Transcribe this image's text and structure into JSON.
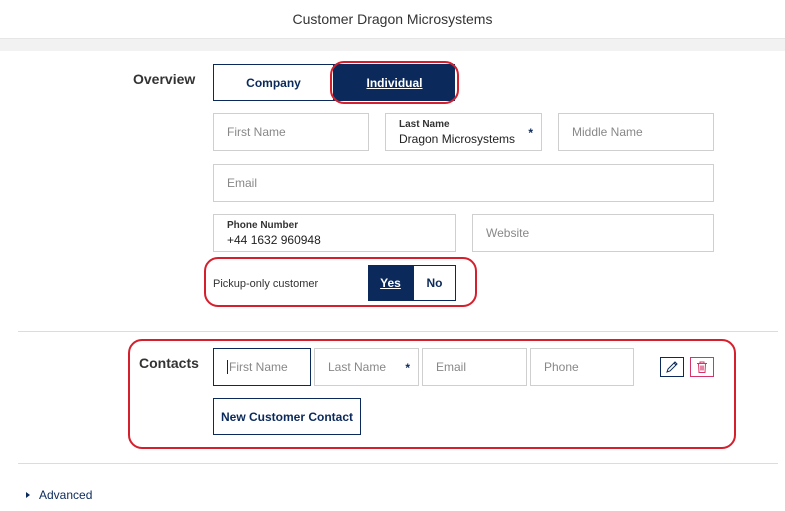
{
  "header": {
    "title": "Customer Dragon Microsystems"
  },
  "overview": {
    "title": "Overview",
    "type_options": {
      "company": "Company",
      "individual": "Individual"
    },
    "first_name": {
      "placeholder": "First Name"
    },
    "last_name": {
      "label": "Last Name",
      "value": "Dragon Microsystems",
      "required_marker": "*"
    },
    "middle_name": {
      "placeholder": "Middle Name"
    },
    "email": {
      "placeholder": "Email"
    },
    "phone": {
      "label": "Phone Number",
      "value": "+44 1632 960948"
    },
    "website": {
      "placeholder": "Website"
    },
    "pickup": {
      "label": "Pickup-only customer",
      "yes": "Yes",
      "no": "No",
      "selected": "Yes"
    }
  },
  "contacts": {
    "title": "Contacts",
    "first_name": {
      "placeholder": "First Name"
    },
    "last_name": {
      "placeholder": "Last Name",
      "required_marker": "*"
    },
    "email": {
      "placeholder": "Email"
    },
    "phone": {
      "placeholder": "Phone"
    },
    "new_button": "New Customer Contact"
  },
  "advanced": {
    "label": "Advanced"
  },
  "colors": {
    "primary": "#0b2a5b",
    "highlight": "#d61f2c",
    "delete": "#d6336c"
  }
}
